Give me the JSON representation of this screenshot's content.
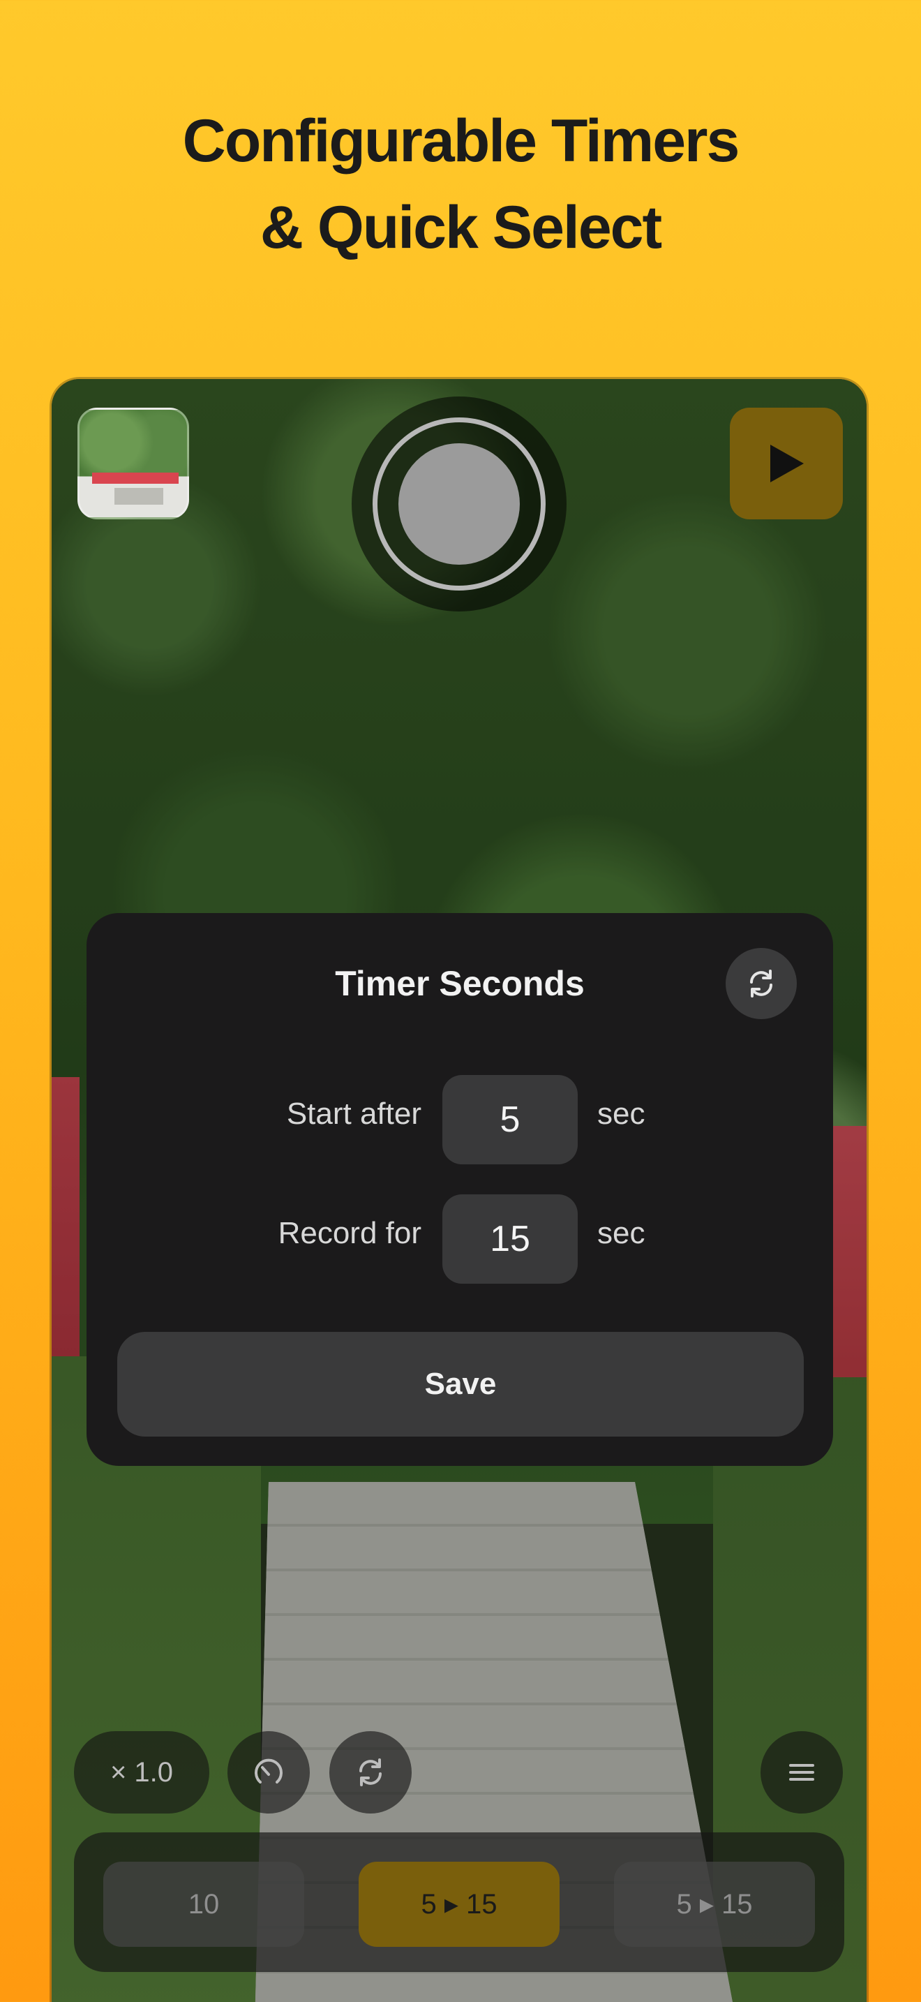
{
  "headline": {
    "line1": "Configurable Timers",
    "line2": "& Quick Select"
  },
  "colors": {
    "background_top": "#ffc92b",
    "background_bottom": "#ff9a10",
    "accent": "#7a5f0c",
    "modal_bg": "#1b1a1b"
  },
  "camera": {
    "thumbnail_icon": "last-recording-thumbnail",
    "record_icon": "record-button",
    "play_icon": "play-icon"
  },
  "modal": {
    "title": "Timer Seconds",
    "reset_icon": "refresh-icon",
    "start_label": "Start after",
    "start_value": "5",
    "start_unit": "sec",
    "record_label": "Record for",
    "record_value": "15",
    "record_unit": "sec",
    "save_label": "Save"
  },
  "toolbar": {
    "zoom_label": "× 1.0",
    "speed_icon": "speedometer-icon",
    "switch_icon": "refresh-icon",
    "menu_icon": "hamburger-menu-icon"
  },
  "quick_select": [
    {
      "label": "10",
      "active": false
    },
    {
      "label": "5 ▸ 15",
      "active": true
    },
    {
      "label": "5 ▸ 15",
      "active": false
    }
  ]
}
